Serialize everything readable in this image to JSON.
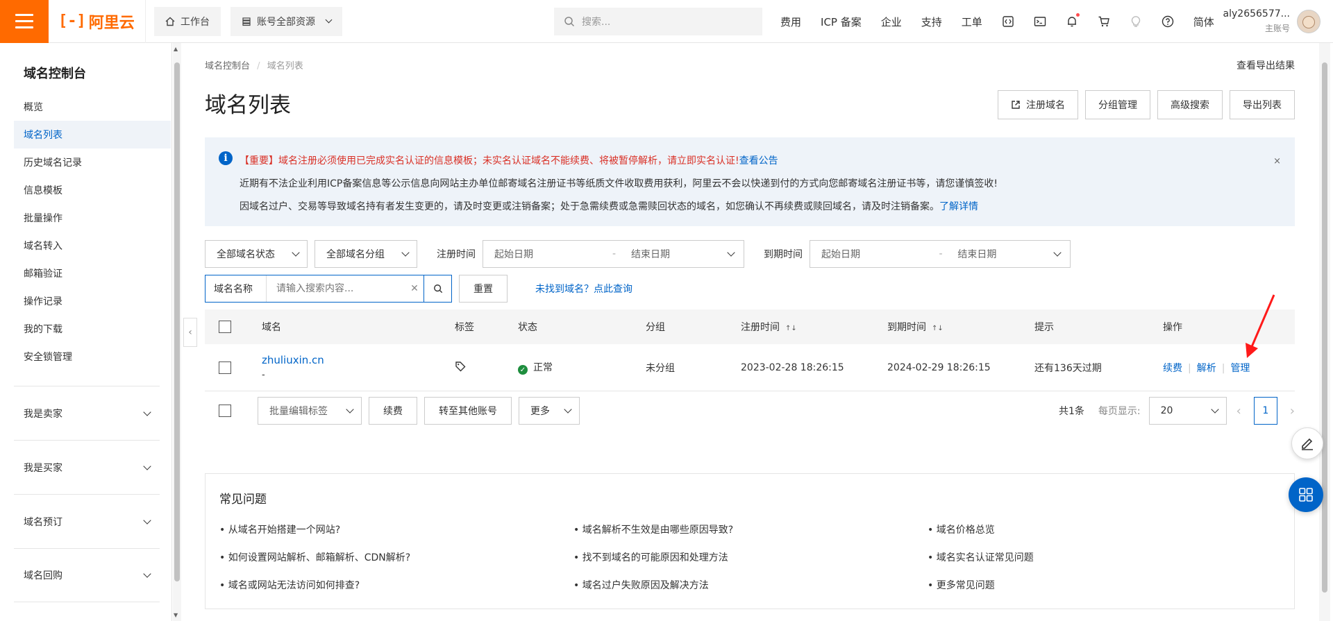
{
  "topbar": {
    "brand": "阿里云",
    "brand_mark": "[-]",
    "workbench": "工作台",
    "resources": "账号全部资源",
    "search_placeholder": "搜索...",
    "links": [
      "费用",
      "ICP 备案",
      "企业",
      "支持",
      "工单"
    ],
    "lang": "简体",
    "user_name": "aly2656577...",
    "user_role": "主账号"
  },
  "sidebar": {
    "title": "域名控制台",
    "items": [
      {
        "label": "概览"
      },
      {
        "label": "域名列表"
      },
      {
        "label": "历史域名记录"
      },
      {
        "label": "信息模板"
      },
      {
        "label": "批量操作"
      },
      {
        "label": "域名转入"
      },
      {
        "label": "邮箱验证"
      },
      {
        "label": "操作记录"
      },
      {
        "label": "我的下载"
      },
      {
        "label": "安全锁管理"
      }
    ],
    "groups": [
      {
        "label": "我是卖家"
      },
      {
        "label": "我是买家"
      },
      {
        "label": "域名预订"
      },
      {
        "label": "域名回购"
      }
    ]
  },
  "main": {
    "breadcrumb_root": "域名控制台",
    "breadcrumb_sep": "/",
    "breadcrumb_current": "域名列表",
    "export_result": "查看导出结果",
    "title": "域名列表",
    "buttons": {
      "register": "注册域名",
      "groups": "分组管理",
      "advanced": "高级搜索",
      "export": "导出列表"
    },
    "notice": {
      "line1_red": "【重要】域名注册必须使用已完成实名认证的信息模板；未实名认证域名不能续费、将被暂停解析，请立即实名认证!",
      "line1_link": "查看公告",
      "line2": "近期有不法企业利用ICP备案信息等公示信息向网站主办单位邮寄域名注册证书等纸质文件收取费用获利，阿里云不会以快递到付的方式向您邮寄域名注册证书等，请您谨慎签收!",
      "line3": "因域名过户、交易等导致域名持有者发生变更的，请及时变更或注销备案；处于急需续费或急需赎回状态的域名，如您确认不再续费或赎回域名，请及时注销备案。",
      "line3_link": "了解详情",
      "close": "×"
    },
    "filters": {
      "status": "全部域名状态",
      "group": "全部域名分组",
      "reg_time_label": "注册时间",
      "exp_time_label": "到期时间",
      "start_date": "起始日期",
      "dash": "-",
      "end_date": "结束日期",
      "field_type": "域名名称",
      "search_placeholder": "请输入搜索内容...",
      "reset": "重置",
      "not_found": "未找到域名？点此查询"
    },
    "table": {
      "headers": [
        "域名",
        "标签",
        "状态",
        "分组",
        "注册时间",
        "到期时间",
        "提示",
        "操作"
      ],
      "rows": [
        {
          "domain": "zhuliuxin.cn",
          "domain_sub": "-",
          "status": "正常",
          "group": "未分组",
          "reg_time": "2023-02-28 18:26:15",
          "exp_time": "2024-02-29 18:26:15",
          "hint": "还有136天过期",
          "actions": [
            "续费",
            "解析",
            "管理"
          ]
        }
      ]
    },
    "bulk": {
      "edit_tags": "批量编辑标签",
      "renew": "续费",
      "transfer": "转至其他账号",
      "more": "更多",
      "total": "共1条",
      "per_page_label": "每页显示:",
      "per_page": "20",
      "current_page": "1"
    },
    "faq": {
      "title": "常见问题",
      "items": [
        "• 从域名开始搭建一个网站?",
        "• 域名解析不生效是由哪些原因导致?",
        "• 域名价格总览",
        "• 如何设置网站解析、邮箱解析、CDN解析?",
        "• 找不到域名的可能原因和处理方法",
        "• 域名实名认证常见问题",
        "• 域名或网站无法访问如何排查?",
        "• 域名过户失败原因及解决方法",
        "• 更多常见问题"
      ]
    }
  },
  "colors": {
    "brand": "#ff6a00",
    "link": "#0064c8",
    "alert_red": "#d93026",
    "ok_green": "#1e8e3e",
    "annotation_arrow": "#ff1a1a"
  }
}
